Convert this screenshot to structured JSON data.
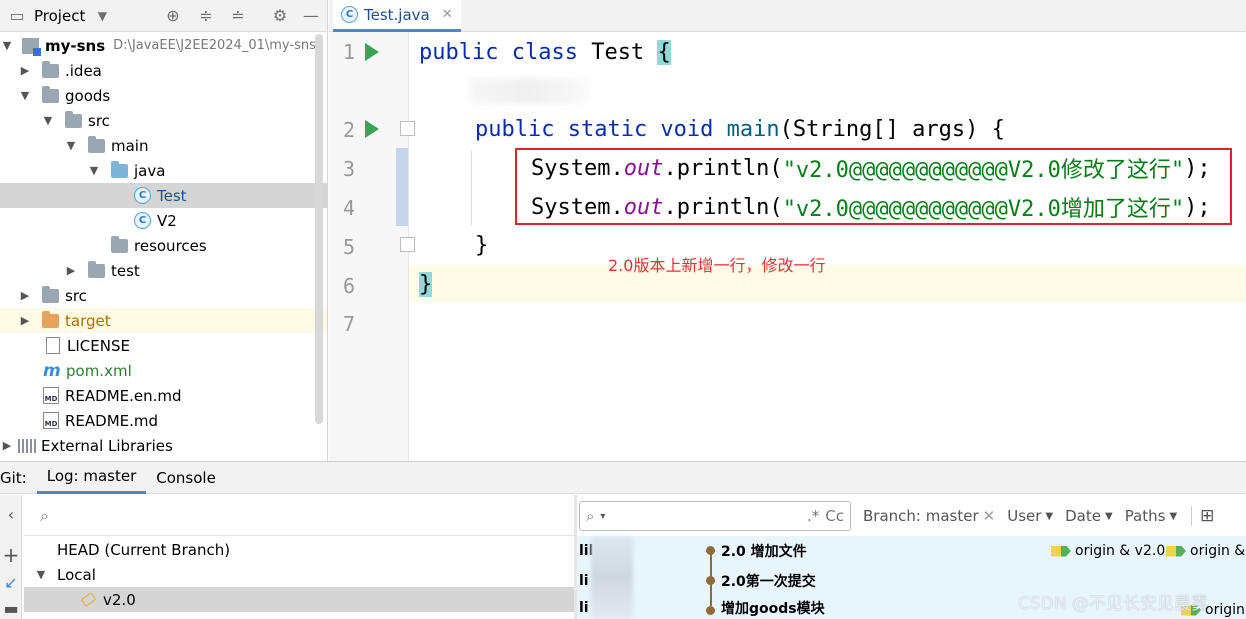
{
  "project_panel": {
    "title": "Project",
    "tree": [
      {
        "label": "my-sns",
        "path": "D:\\JavaEE\\J2EE2024_01\\my-sns"
      },
      {
        "label": ".idea"
      },
      {
        "label": "goods"
      },
      {
        "label": "src"
      },
      {
        "label": "main"
      },
      {
        "label": "java"
      },
      {
        "label": "Test"
      },
      {
        "label": "V2"
      },
      {
        "label": "resources"
      },
      {
        "label": "test"
      },
      {
        "label": "src"
      },
      {
        "label": "target"
      },
      {
        "label": "LICENSE"
      },
      {
        "label": "pom.xml"
      },
      {
        "label": "README.en.md"
      },
      {
        "label": "README.md"
      },
      {
        "label": "External Libraries"
      }
    ],
    "md_badge": "MD",
    "class_badge": "C"
  },
  "editor": {
    "tab_label": "Test.java",
    "line_numbers": [
      "1",
      "2",
      "3",
      "4",
      "5",
      "6",
      "7"
    ],
    "code": {
      "l1_kw": "public class",
      "l1_name": " Test ",
      "l1_brace": "{",
      "l2_kw": "public static void",
      "l2_method": " main",
      "l2_rest": "(String[] args) {",
      "l3_pre": "System.",
      "l3_field": "out",
      "l3_call": ".println(",
      "l3_str": "\"v2.0@@@@@@@@@@@@V2.0修改了这行\"",
      "l3_end": ");",
      "l4_pre": "System.",
      "l4_field": "out",
      "l4_call": ".println(",
      "l4_str": "\"v2.0@@@@@@@@@@@@V2.0增加了这行\"",
      "l4_end": ");",
      "l5": "}",
      "l6": "}"
    },
    "annotation": "2.0版本上新增一行，修改一行"
  },
  "git_panel": {
    "tabs": [
      "Git:",
      "Log: master",
      "Console"
    ],
    "branches": {
      "head": "HEAD (Current Branch)",
      "local": "Local",
      "selected_branch": "v2.0"
    },
    "log_toolbar": {
      "regex_toggle": ".*",
      "case_toggle": "Cc",
      "branch_filter": "Branch: master",
      "user_filter": "User",
      "date_filter": "Date",
      "paths_filter": "Paths"
    },
    "commits": [
      {
        "author": "lil",
        "message": "2.0 增加文件",
        "refs": [
          "origin & v2.0",
          "origin &"
        ]
      },
      {
        "author": "li",
        "message": "2.0第一次提交",
        "refs": []
      },
      {
        "author": "li",
        "message": "增加goods模块",
        "refs": [
          "origin"
        ]
      }
    ]
  },
  "watermark": "CSDN @不见长安见晨雾"
}
